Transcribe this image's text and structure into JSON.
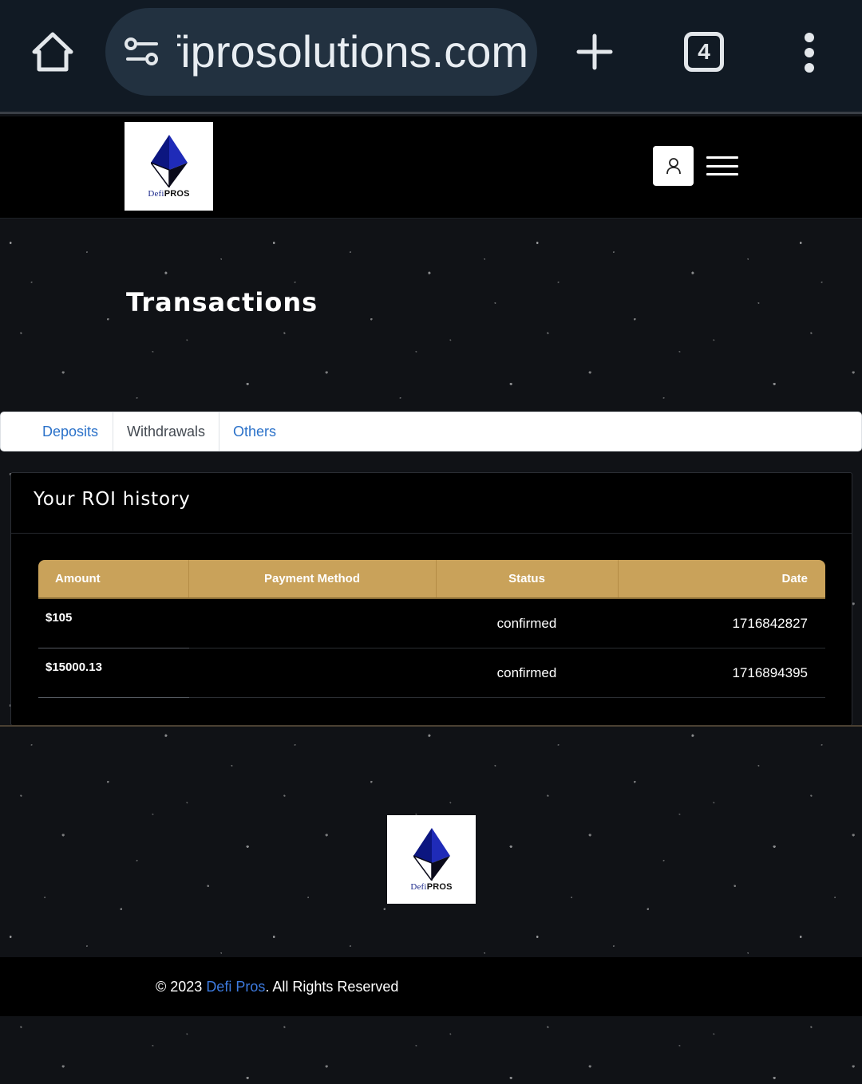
{
  "browser": {
    "url_text": "defiprosolutions.com",
    "tab_count": "4",
    "icons": [
      "home-icon",
      "site-settings-icon",
      "plus-icon",
      "more-vert-icon"
    ]
  },
  "header": {
    "logo": {
      "word_defi": "Defi",
      "word_pros": "PROS"
    },
    "icons": [
      "user-icon",
      "hamburger-icon"
    ]
  },
  "page": {
    "title": "Transactions"
  },
  "tabs": [
    {
      "label": "Deposits",
      "active": false
    },
    {
      "label": "Withdrawals",
      "active": true
    },
    {
      "label": "Others",
      "active": false
    }
  ],
  "card": {
    "title": "Your ROI history",
    "columns": [
      "Amount",
      "Payment Method",
      "Status",
      "Date"
    ],
    "rows": [
      {
        "amount": "$105",
        "payment_method": "",
        "status": "confirmed",
        "date": "1716842827"
      },
      {
        "amount": "$15000.13",
        "payment_method": "",
        "status": "confirmed",
        "date": "1716894395"
      }
    ]
  },
  "footer": {
    "copyright_prefix": "© 2023 ",
    "brand": "Defi Pros",
    "copyright_suffix": ". All Rights Reserved"
  },
  "colors": {
    "accent_gold": "#c9a25a",
    "link_blue": "#2a71c9",
    "logo_blue": "#1f2bb8",
    "browser_bar": "#111a24"
  }
}
